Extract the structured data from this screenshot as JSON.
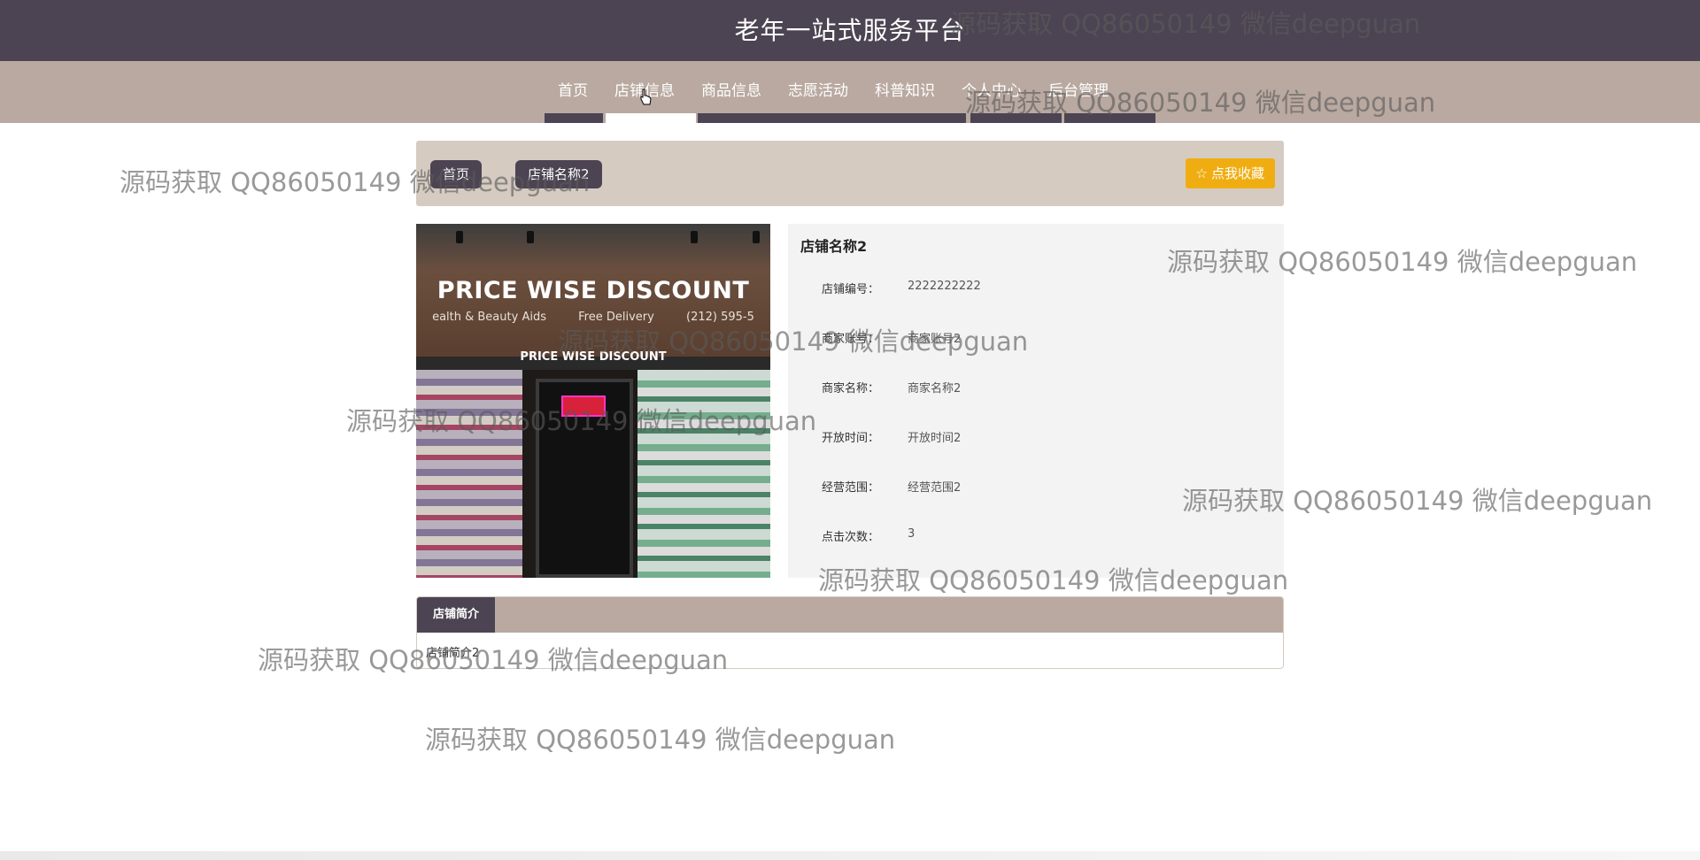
{
  "header": {
    "title": "老年一站式服务平台"
  },
  "nav": {
    "items": [
      {
        "label": "首页"
      },
      {
        "label": "店铺信息"
      },
      {
        "label": "商品信息"
      },
      {
        "label": "志愿活动"
      },
      {
        "label": "科普知识"
      },
      {
        "label": "个人中心"
      },
      {
        "label": "后台管理"
      }
    ],
    "active_index": 1
  },
  "breadcrumb": {
    "home": "首页",
    "current": "店铺名称2"
  },
  "favorite_button": {
    "label": "点我收藏",
    "icon": "star-icon"
  },
  "photo": {
    "sign_main": "PRICE WISE DISCOUNT",
    "sign_left": "ealth & Beauty Aids",
    "sign_mid": "Free Delivery",
    "sign_right": "(212) 595-5",
    "sign_small": "PRICE WISE DISCOUNT"
  },
  "store": {
    "name": "店铺名称2",
    "fields": [
      {
        "label": "店铺编号：",
        "value": "2222222222"
      },
      {
        "label": "商家账号：",
        "value": "商家账号2"
      },
      {
        "label": "商家名称：",
        "value": "商家名称2"
      },
      {
        "label": "开放时间：",
        "value": "开放时间2"
      },
      {
        "label": "经营范围：",
        "value": "经营范围2"
      },
      {
        "label": "点击次数：",
        "value": "3"
      }
    ]
  },
  "intro": {
    "tab_label": "店铺简介",
    "content": "店铺简介2"
  },
  "watermark": {
    "text": "源码获取 QQ86050149 微信deepguan"
  },
  "colors": {
    "header": "#4c4452",
    "nav": "#b9a9a0",
    "breadcrumb": "#d5cbc1",
    "favorite": "#f0ad12"
  }
}
